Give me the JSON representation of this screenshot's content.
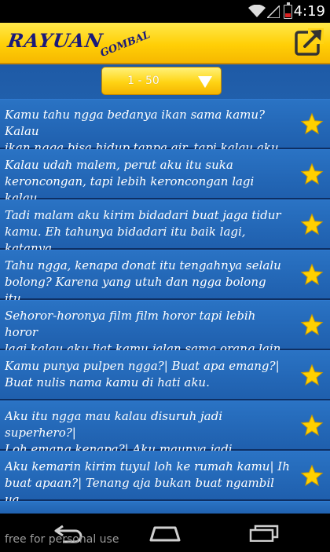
{
  "status": {
    "time": "4:19"
  },
  "header": {
    "logo_main": "RAYUAN",
    "logo_sub": "GOMBAL",
    "share_icon": "share-icon"
  },
  "range": {
    "label": "1 - 50"
  },
  "items": [
    {
      "text": "Kamu tahu ngga bedanya ikan sama kamu? Kalau\nikan ngga bisa hidup tanpa air, tapi kalau aku..."
    },
    {
      "text": "Kalau udah malem, perut aku itu suka\nkeroncongan, tapi lebih keroncongan lagi kalau..."
    },
    {
      "text": "Tadi malam aku kirim bidadari buat jaga tidur\nkamu. Eh tahunya bidadari itu baik lagi, katanya..."
    },
    {
      "text": "Tahu ngga, kenapa donat itu tengahnya selalu\nbolong? Karena yang utuh dan ngga bolong itu..."
    },
    {
      "text": "Sehoror-horonya film film horor tapi lebih horor\nlagi kalau aku liat kamu jalan sama orang lain."
    },
    {
      "text": "Kamu punya pulpen ngga?| Buat apa emang?|\nBuat nulis nama kamu di hati aku."
    },
    {
      "text": "Aku itu ngga mau kalau disuruh jadi superhero?|\nLoh emang kenapa?| Aku maunya jadi SuperDad..."
    },
    {
      "text": "Aku kemarin kirim tuyul loh ke rumah kamu| Ih\nbuat apaan?| Tenang aja bukan buat ngambil ua..."
    }
  ],
  "colors": {
    "header": "#ffd414",
    "list_bg": "#2a73c4",
    "star": "#ffd000"
  },
  "watermark": "free for personal use"
}
